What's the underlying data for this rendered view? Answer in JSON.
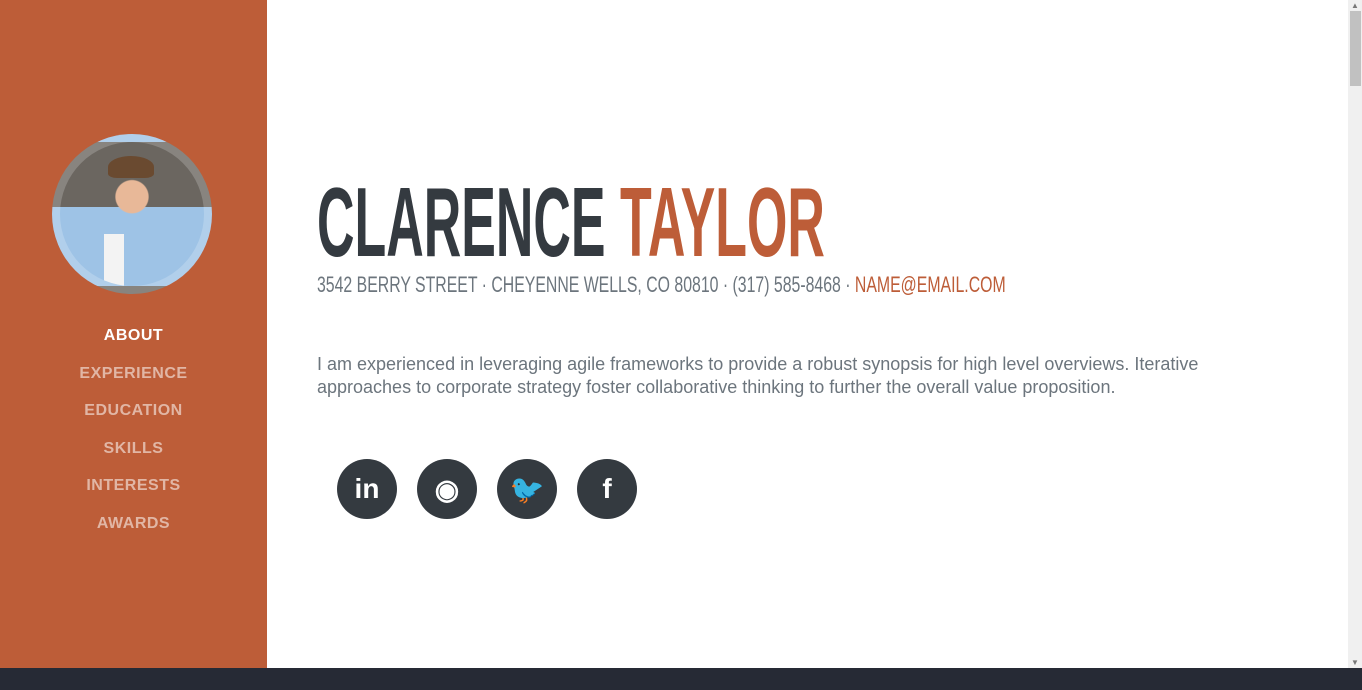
{
  "sidebar": {
    "nav": [
      {
        "label": "ABOUT"
      },
      {
        "label": "EXPERIENCE"
      },
      {
        "label": "EDUCATION"
      },
      {
        "label": "SKILLS"
      },
      {
        "label": "INTERESTS"
      },
      {
        "label": "AWARDS"
      }
    ]
  },
  "header": {
    "first_name": "CLARENCE",
    "last_name": "TAYLOR",
    "address": "3542 BERRY STREET · CHEYENNE WELLS, CO 80810 · (317) 585-8468 · ",
    "email": "NAME@EMAIL.COM"
  },
  "bio": "I am experienced in leveraging agile frameworks to provide a robust synopsis for high level overviews. Iterative approaches to corporate strategy foster collaborative thinking to further the overall value proposition.",
  "social": [
    {
      "icon": "linkedin-icon",
      "glyph": "in"
    },
    {
      "icon": "github-icon",
      "glyph": "◉"
    },
    {
      "icon": "twitter-icon",
      "glyph": "🐦"
    },
    {
      "icon": "facebook-icon",
      "glyph": "f"
    }
  ],
  "colors": {
    "primary": "#bd5d38",
    "dark": "#343a40",
    "muted": "#6c757d"
  }
}
